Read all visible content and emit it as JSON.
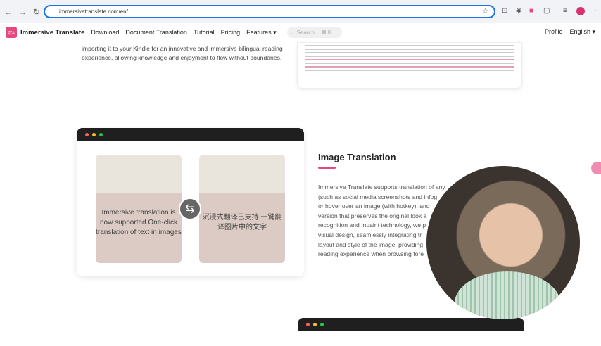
{
  "browser": {
    "url": "immersivetranslate.com/en/"
  },
  "site": {
    "brand": "Immersive Translate",
    "logo_text": "沉A",
    "nav": [
      "Download",
      "Document Translation",
      "Tutorial",
      "Pricing",
      "Features ▾"
    ],
    "search_placeholder": "Search",
    "search_shortcut": "⌘ K",
    "profile": "Profile",
    "language": "English ▾"
  },
  "intro": "importing it to your Kindle for an innovative and immersive bilingual reading experience, allowing knowledge and enjoyment to flow without boundaries.",
  "feature": {
    "title": "Image Translation",
    "original_image_text": "Immersive translation is now supported One-click translation of text in images",
    "translated_image_text": "沉浸式翻译已支持 一键翻译图片中的文字",
    "description_lines": [
      "Immersive Translate supports translation of any",
      "(such as social media screenshots and infog",
      "or hover over an image (with hotkey), and",
      "version that preserves the original look a",
      "recognition and Inpaint technology, we p",
      "visual design, seamlessly integrating tr",
      "layout and style of the image, providing",
      "reading experience when browsing fore"
    ]
  },
  "colors": {
    "accent": "#e5487e"
  }
}
